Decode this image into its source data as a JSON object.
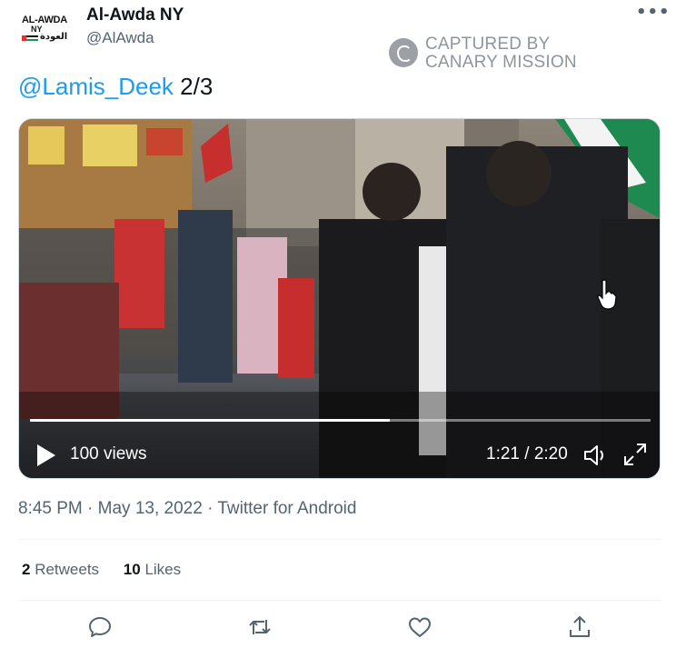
{
  "author": {
    "display_name": "Al-Awda NY",
    "handle": "@AlAwda",
    "avatar_text": {
      "line1": "AL-AWDA",
      "line2": "NY",
      "line3": "العودة"
    }
  },
  "more_icon": "more-horizontal-icon",
  "more_glyph": "•••",
  "watermark": {
    "line1": "CAPTURED BY",
    "line2": "CANARY MISSION",
    "icon": "canary-bird-icon"
  },
  "tweet": {
    "mention": "@Lamis_Deek",
    "text": " 2/3"
  },
  "video": {
    "views": "100 views",
    "timecode": "1:21 / 2:20",
    "progress": 0.58,
    "icons": {
      "play": "play-icon",
      "volume": "volume-icon",
      "fullscreen": "fullscreen-icon"
    }
  },
  "meta": {
    "time": "8:45 PM",
    "date": "May 13, 2022",
    "source": "Twitter for Android",
    "separator": " · "
  },
  "stats": {
    "retweets": {
      "count": "2",
      "label": " Retweets"
    },
    "likes": {
      "count": "10",
      "label": " Likes"
    }
  },
  "actions": [
    {
      "icon": "reply-icon"
    },
    {
      "icon": "retweet-icon"
    },
    {
      "icon": "like-icon"
    },
    {
      "icon": "share-icon"
    }
  ],
  "colors": {
    "link": "#1d9bf0",
    "secondary_text": "#536471",
    "primary_text": "#0f1419",
    "divider": "#eff3f4"
  }
}
